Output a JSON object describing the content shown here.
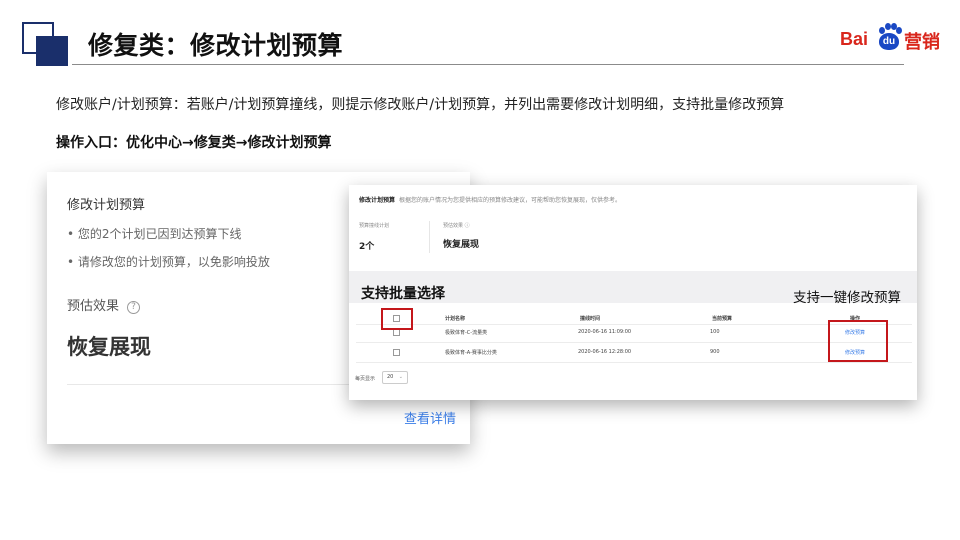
{
  "header": {
    "title": "修复类：修改计划预算",
    "logo": {
      "bai": "Bai",
      "du": "du",
      "ying": "营销"
    }
  },
  "description": "修改账户/计划预算：若账户/计划预算撞线，则提示修改账户/计划预算，并列出需要修改计划明细，支持批量修改预算",
  "entry_path": "操作入口：优化中心→修复类→修改计划预算",
  "left_card": {
    "title": "修改计划预算",
    "bullet1": "• 您的2个计划已因到达预算下线",
    "bullet2": "• 请修改您的计划预算，以免影响投放",
    "estimate_label": "预估效果",
    "help_glyph": "?",
    "estimate_value": "恢复展现",
    "detail_link": "查看详情"
  },
  "right_panel": {
    "title": "修改计划预算",
    "subtitle": "根据您的账户情况为您提供相应的预算修改建议，可能帮助您恢复展现，仅供参考。",
    "stat1_label": "预算撞线计划",
    "stat1_value": "2个",
    "stat2_label": "预估效果 ⓘ",
    "stat2_value": "恢复展现",
    "batch_label": "支持批量选择",
    "onekey_label": "支持一键修改预算",
    "table": {
      "headers": {
        "name": "计划名称",
        "time": "撞线时间",
        "budget": "当前预算",
        "action": "操作"
      },
      "rows": [
        {
          "name": "极致体育-C-流量类",
          "time": "2020-06-16 11:09:00",
          "budget": "100",
          "action": "修改预算"
        },
        {
          "name": "极致体育-A-赛事比分类",
          "time": "2020-06-16 12:28:00",
          "budget": "900",
          "action": "修改预算"
        }
      ]
    },
    "pager": {
      "label": "每页显示",
      "value": "20",
      "chevron": "⌄"
    }
  },
  "colors": {
    "navy": "#1a2f6b",
    "red": "#c4171b",
    "link": "#3b7ee8",
    "baidu_red": "#d9261c",
    "baidu_blue": "#1a48c4"
  }
}
